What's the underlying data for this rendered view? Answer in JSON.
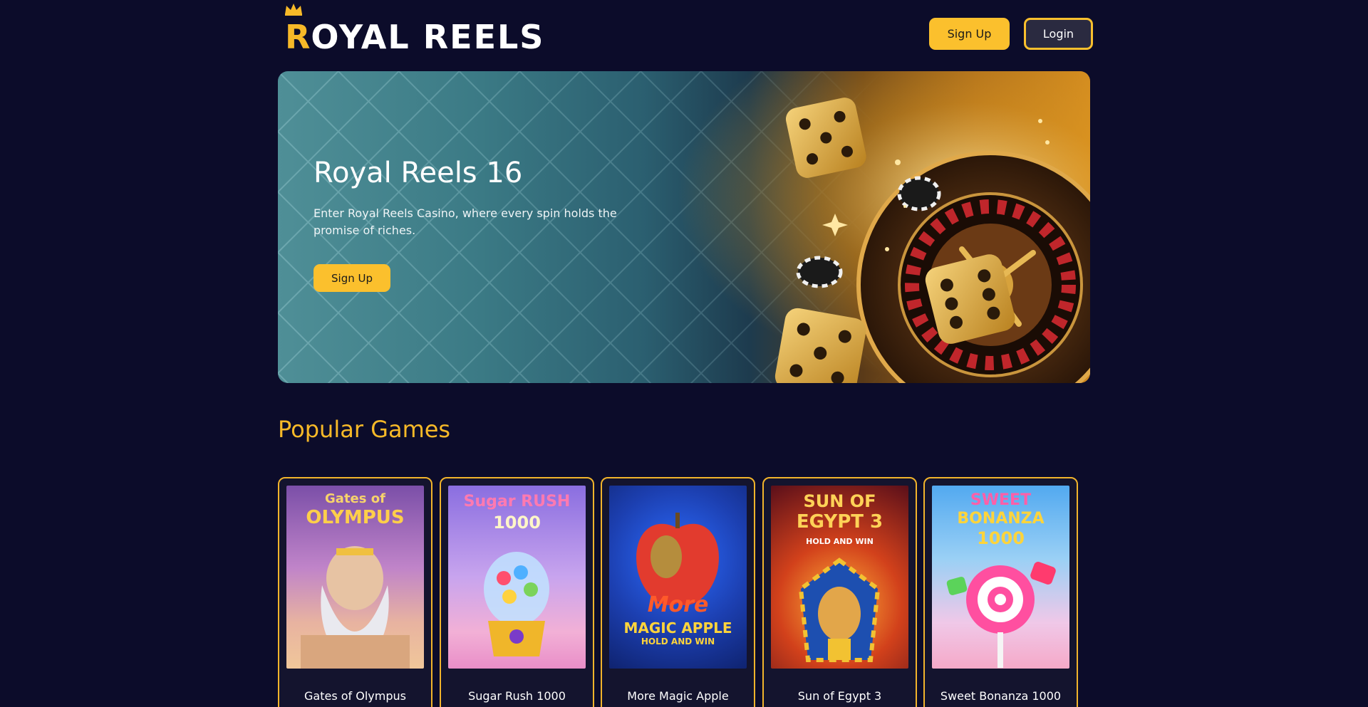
{
  "header": {
    "logo_first": "R",
    "logo_rest": "OYAL REELS",
    "signup_label": "Sign Up",
    "login_label": "Login"
  },
  "hero": {
    "title": "Royal Reels 16",
    "subtitle": "Enter Royal Reels Casino, where every spin holds the promise of riches.",
    "cta_label": "Sign Up"
  },
  "popular": {
    "title": "Popular Games",
    "games": [
      {
        "name": "Gates of Olympus",
        "art_line1": "Gates of",
        "art_line2": "OLYMPUS"
      },
      {
        "name": "Sugar Rush 1000",
        "art_line1": "Sugar RUSH",
        "art_line2": "1000"
      },
      {
        "name": "More Magic Apple",
        "art_line1": "More",
        "art_line2": "MAGIC APPLE",
        "art_line3": "HOLD AND WIN"
      },
      {
        "name": "Sun of Egypt 3",
        "art_line1": "SUN OF",
        "art_line2": "EGYPT 3",
        "art_line3": "HOLD AND WIN"
      },
      {
        "name": "Sweet Bonanza 1000",
        "art_line1": "SWEET",
        "art_line2": "BONANZA",
        "art_line3": "1000"
      }
    ]
  },
  "colors": {
    "background": "#0c0c2a",
    "accent": "#fbc02d",
    "heading": "#f7b928"
  },
  "icons": {
    "logo_crown": "crown-icon"
  }
}
